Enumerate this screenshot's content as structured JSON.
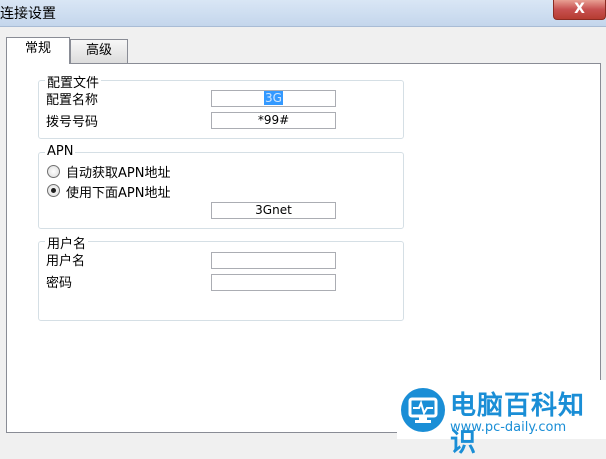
{
  "window": {
    "title": "连接设置",
    "close_symbol": "X"
  },
  "tabs": [
    {
      "label": "常规",
      "active": true
    },
    {
      "label": "高级",
      "active": false
    }
  ],
  "profile": {
    "group_title": "配置文件",
    "name_label": "配置名称",
    "name_value": "3G",
    "dial_label": "拨号号码",
    "dial_value": "*99#"
  },
  "apn": {
    "group_title": "APN",
    "auto_label": "自动获取APN地址",
    "manual_label": "使用下面APN地址",
    "selected": "manual",
    "value": "3Gnet"
  },
  "user": {
    "group_title": "用户名",
    "username_label": "用户名",
    "username_value": "",
    "password_label": "密码",
    "password_value": ""
  },
  "watermark": {
    "name": "电脑百科知识",
    "url": "www.pc-daily.com",
    "accent": "#1a8ed6"
  }
}
